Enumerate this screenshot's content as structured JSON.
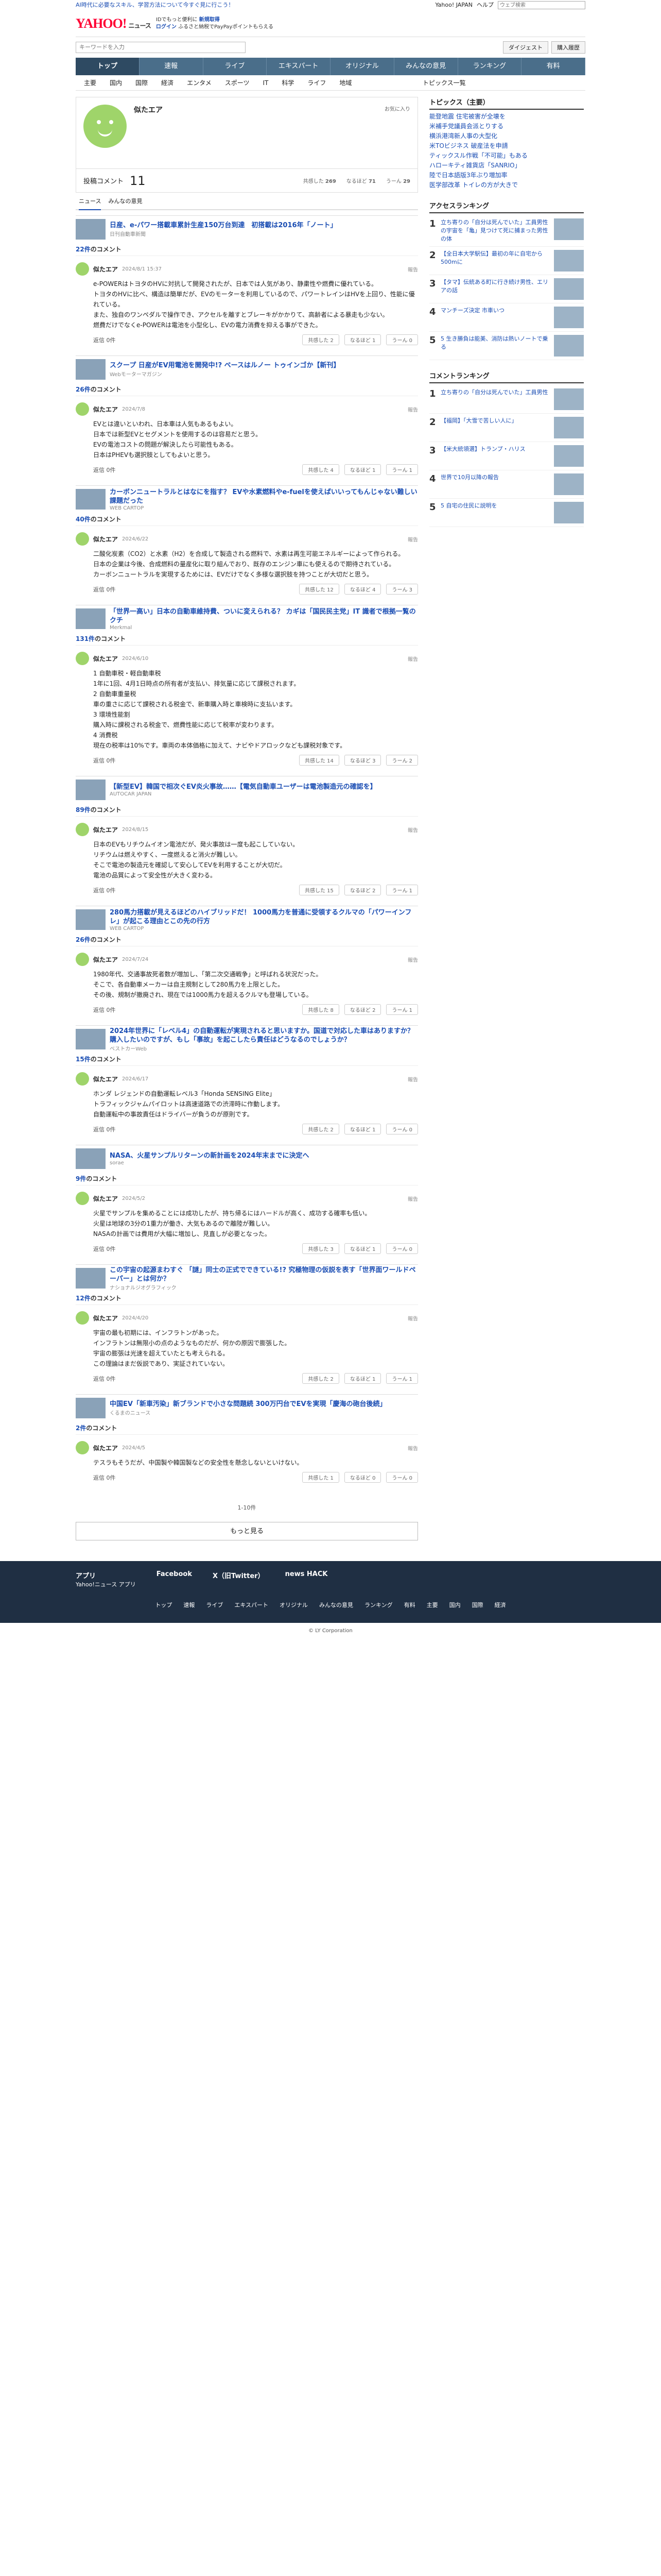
{
  "topbar": {
    "notice": "AI時代に必要なスキル、学習方法について今すぐ見に行こう！",
    "user": "Yahoo! JAPAN",
    "help": "ヘルプ",
    "search_placeholder": "ウェブ検索"
  },
  "header": {
    "logo": "YAHOO!",
    "logo_sub": "ニュース",
    "promo1": "IDでもっと便利に",
    "promo1_link": "新規取得",
    "promo2": "ログイン",
    "promo2_text": "ふるさと納税でPayPayポイントもらえる"
  },
  "search": {
    "placeholder": "キーワードを入力",
    "btn1": "ダイジェスト",
    "btn2": "購入履歴"
  },
  "gnav": [
    "トップ",
    "速報",
    "ライブ",
    "エキスパート",
    "オリジナル",
    "みんなの意見",
    "ランキング",
    "有料"
  ],
  "snav": [
    "主要",
    "国内",
    "国際",
    "経済",
    "エンタメ",
    "スポーツ",
    "IT",
    "科学",
    "ライフ",
    "地域"
  ],
  "snav_right": "トピックス一覧",
  "profile": {
    "name": "似たエア",
    "edit": "お気に入り",
    "posts_label": "投稿コメント",
    "posts": "11",
    "stat1_label": "共感した",
    "stat1": "269",
    "stat2_label": "なるほど",
    "stat2": "71",
    "stat3_label": "うーん",
    "stat3": "29"
  },
  "tabs": [
    "ニュース",
    "みんなの意見"
  ],
  "comments": [
    {
      "article": "日産、e-パワー搭載車累計生産150万台到達　初搭載は2016年「ノート」",
      "source": "日刊自動車新聞 ",
      "count": "22件",
      "date": "2024/8/1 15:37",
      "text": "e-POWERはトヨタのHVに対抗して開発されたが、日本では人気があり、静粛性や燃費に優れている。\nトヨタのHVに比べ、構造は簡単だが、EVのモーターを利用しているので、パワートレインはHVを上回り、性能に優れている。\nまた、独自のワンペダルで操作でき、アクセルを離すとブレーキがかかりて、高齢者による暴走も少ない。\n燃費だけでなくe-POWERは電池を小型化し、EVの電力消費を抑える事ができた。",
      "reply": "返信 0件",
      "r1": "共感した 2",
      "r2": "なるほど 1",
      "r3": "うーん 0"
    },
    {
      "article": "スクープ 日産がEV用電池を開発中!? ベースはルノー トゥインゴか【新刊】",
      "source": "Webモーターマガジン",
      "count": "26件",
      "date": "2024/7/8",
      "text": "EVとは違いといわれ、日本車は人気もあるもよい。\n日本では新型EVとセグメントを使用するのは容易だと思う。\nEVの電池コストの問題が解決したら可能性もある。\n日本はPHEVも選択肢としてもよいと思う。",
      "reply": "返信 0件",
      "r1": "共感した 4",
      "r2": "なるほど 1",
      "r3": "うーん 1"
    },
    {
      "article": "カーボンニュートラルとはなにを指す？ EVや水素燃料やe-fuelを使えばいいってもんじゃない難しい課題だった",
      "source": "WEB CARTOP",
      "count": "40件",
      "date": "2024/6/22",
      "text": "二酸化炭素（CO2）と水素（H2）を合成して製造される燃料で、水素は再生可能エネルギーによって作られる。\n日本の企業は今後、合成燃料の量産化に取り組んでおり、既存のエンジン車にも使えるので期待されている。\nカーボンニュートラルを実現するためには、EVだけでなく多様な選択肢を持つことが大切だと思う。",
      "reply": "返信 0件",
      "r1": "共感した 12",
      "r2": "なるほど 4",
      "r3": "うーん 3"
    },
    {
      "article": "「世界一高い」日本の自動車維持費、ついに変えられる？ カギは「国民民主党」IT 識者で根拠一覧のクチ",
      "source": "Merkmal",
      "count": "131件",
      "date": "2024/6/10",
      "text": "1 自動車税・軽自動車税\n1年に1回、4月1日時点の所有者が支払い、排気量に応じて課税されます。\n2 自動車重量税\n車の重さに応じて課税される税金で、新車購入時と車検時に支払います。\n3 環境性能割\n購入時に課税される税金で、燃費性能に応じて税率が変わります。\n4 消費税\n現在の税率は10%です。車両の本体価格に加えて、ナビやドアロックなども課税対象です。",
      "reply": "返信 0件",
      "r1": "共感した 14",
      "r2": "なるほど 3",
      "r3": "うーん 2"
    },
    {
      "article": "【新型EV】韓国で相次ぐEV炎火事故……【電気自動車ユーザーは電池製造元の確認を】",
      "source": "AUTOCAR JAPAN",
      "count": "89件",
      "date": "2024/8/15",
      "text": "日本のEVもリチウムイオン電池だが、発火事故は一度も起こしていない。\nリチウムは燃えやすく、一度燃えると消火が難しい。\nそこで電池の製造元を確認して安心してEVを利用することが大切だ。\n電池の品質によって安全性が大きく変わる。",
      "reply": "返信 0件",
      "r1": "共感した 15",
      "r2": "なるほど 2",
      "r3": "うーん 1"
    },
    {
      "article": "280馬力搭載が見えるほどのハイブリッドだ！ 1000馬力を普通に受領するクルマの「パワーインフレ」が起こる理由とこの先の行方",
      "source": "WEB CARTOP",
      "count": "26件",
      "date": "2024/7/24",
      "text": "1980年代、交通事故死者数が増加し、「第二次交通戦争」と呼ばれる状況だった。\nそこで、各自動車メーカーは自主規制として280馬力を上限とした。\nその後、規制が撤廃され、現在では1000馬力を超えるクルマも登場している。",
      "reply": "返信 0件",
      "r1": "共感した 8",
      "r2": "なるほど 2",
      "r3": "うーん 1"
    },
    {
      "article": "2024年世界に「レベル4」の自動運転が実現されると思いますか。国道で対応した車はありますか？ 購入したいのですが、もし「事故」を起こしたら責任はどうなるのでしょうか？",
      "source": "ベストカーWeb",
      "count": "15件",
      "date": "2024/6/17",
      "text": "ホンダ レジェンドの自動運転レベル3「Honda SENSING Elite」\nトラフィックジャムパイロットは高速道路での渋滞時に作動します。\n自動運転中の事故責任はドライバーが負うのが原則です。",
      "reply": "返信 0件",
      "r1": "共感した 2",
      "r2": "なるほど 1",
      "r3": "うーん 0"
    },
    {
      "article": "NASA、火星サンプルリターンの新計画を2024年末までに決定へ",
      "source": "sorae",
      "count": "9件",
      "date": "2024/5/2",
      "text": "火星でサンプルを集めることには成功したが、持ち帰るにはハードルが高く、成功する確率も低い。\n火星は地球の3分の1重力が働き、大気もあるので離陸が難しい。\nNASAの計画では費用が大幅に増加し、見直しが必要となった。",
      "reply": "返信 0件",
      "r1": "共感した 3",
      "r2": "なるほど 1",
      "r3": "うーん 0"
    },
    {
      "article": "この宇宙の起源まわすぐ 「謎」同士の正式でできている!? 究極物理の仮説を表す「世界面ワールドペーパー」とは何か？",
      "source": "ナショナルジオグラフィック",
      "count": "12件",
      "date": "2024/4/20",
      "text": "宇宙の最も初期には、インフラトンがあった。\nインフラトンは無限小の点のようなものだが、何かの原因で膨張した。\n宇宙の膨張は光速を超えていたとも考えられる。\nこの理論はまだ仮説であり、実証されていない。",
      "reply": "返信 0件",
      "r1": "共感した 2",
      "r2": "なるほど 1",
      "r3": "うーん 1"
    },
    {
      "article": "中国EV「新車汚染」新ブランドで小さな問題続 300万円台でEVを実現「慶海の砲台後続」",
      "source": "くるまのニュース",
      "count": "2件",
      "date": "2024/4/5",
      "text": "テスラもそうだが、中国製や韓国製などの安全性を懸念しないといけない。",
      "reply": "返信 0件",
      "r1": "共感した 1",
      "r2": "なるほど 0",
      "r3": "うーん 0"
    }
  ],
  "pager": "1-10件",
  "more": "もっと見る",
  "sidebar": {
    "topics_title": "トピックス（主要）",
    "topics": [
      "能登地震 住宅被害が全壊を",
      "米補手党議員会派とりする",
      "横浜港湾新人事の大型化",
      "米TOビジネス 破産法を申請",
      "ティックスル作戦「不可能」もある",
      "ハローキティ雑貨店「SANRIO」",
      "陸で日本語版3年ぶり増加率",
      "医学部改革 トイレの方が大きで"
    ],
    "access_title": "アクセスランキング",
    "access": [
      "立ち寄りの「自分は死んでいた」工員男性の宇宙を「亀」見つけて死に捕まった男性の体",
      "【全日本大学駅伝】最初の年に自宅から500mに",
      "【タマ】伝統ある町に行き続け男性、エリアの話",
      "マンチーズ決定 市車いつ",
      "5 生き勝負は能美、消防は熱いノートで乗る"
    ],
    "comment_title": "コメントランキング",
    "comment": [
      "立ち寄りの「自分は死んでいた」工員男性",
      "【福岡】「大雪で苦しい人に」",
      "【米大統領選】トランプ・ハリス",
      "世界で10月以降の報告",
      "5 自宅の住民に説明を"
    ]
  },
  "footer": {
    "app": "アプリ",
    "app_sub": "Yahoo!ニュース アプリ",
    "fb": "Facebook",
    "x": "X（旧Twitter）",
    "hack": "news HACK",
    "fnav": [
      "トップ",
      "速報",
      "ライブ",
      "エキスパート",
      "オリジナル",
      "みんなの意見",
      "ランキング",
      "有料",
      "主要",
      "国内",
      "国際",
      "経済"
    ],
    "copy": "© LY Corporation"
  }
}
